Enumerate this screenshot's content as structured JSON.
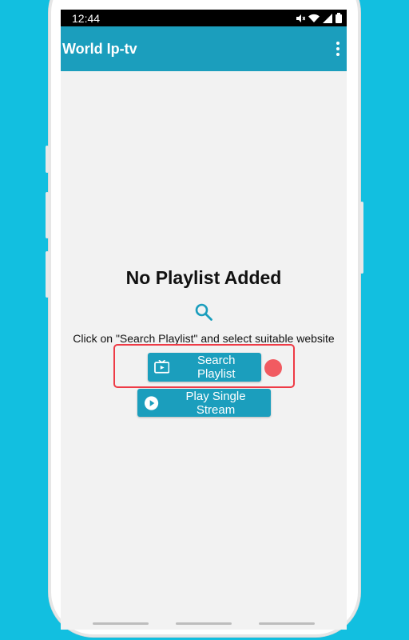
{
  "status_bar": {
    "time": "12:44",
    "icons": [
      "mute-icon",
      "wifi-icon",
      "signal-icon",
      "battery-icon"
    ]
  },
  "app_bar": {
    "title": "World Ip-tv",
    "menu_icon": "more-vert-icon"
  },
  "empty_state": {
    "title": "No Playlist Added",
    "icon": "search-icon",
    "hint": "Click on \"Search Playlist\" and select suitable website"
  },
  "buttons": {
    "search_playlist": {
      "label": "Search Playlist",
      "icon": "tv-icon"
    },
    "play_single_stream": {
      "label": "Play Single Stream",
      "icon": "play-circle-icon"
    }
  },
  "colors": {
    "background": "#12bfe0",
    "accent": "#1b9ebd",
    "highlight": "#ee3b46",
    "indicator_dot": "#f15b61"
  }
}
